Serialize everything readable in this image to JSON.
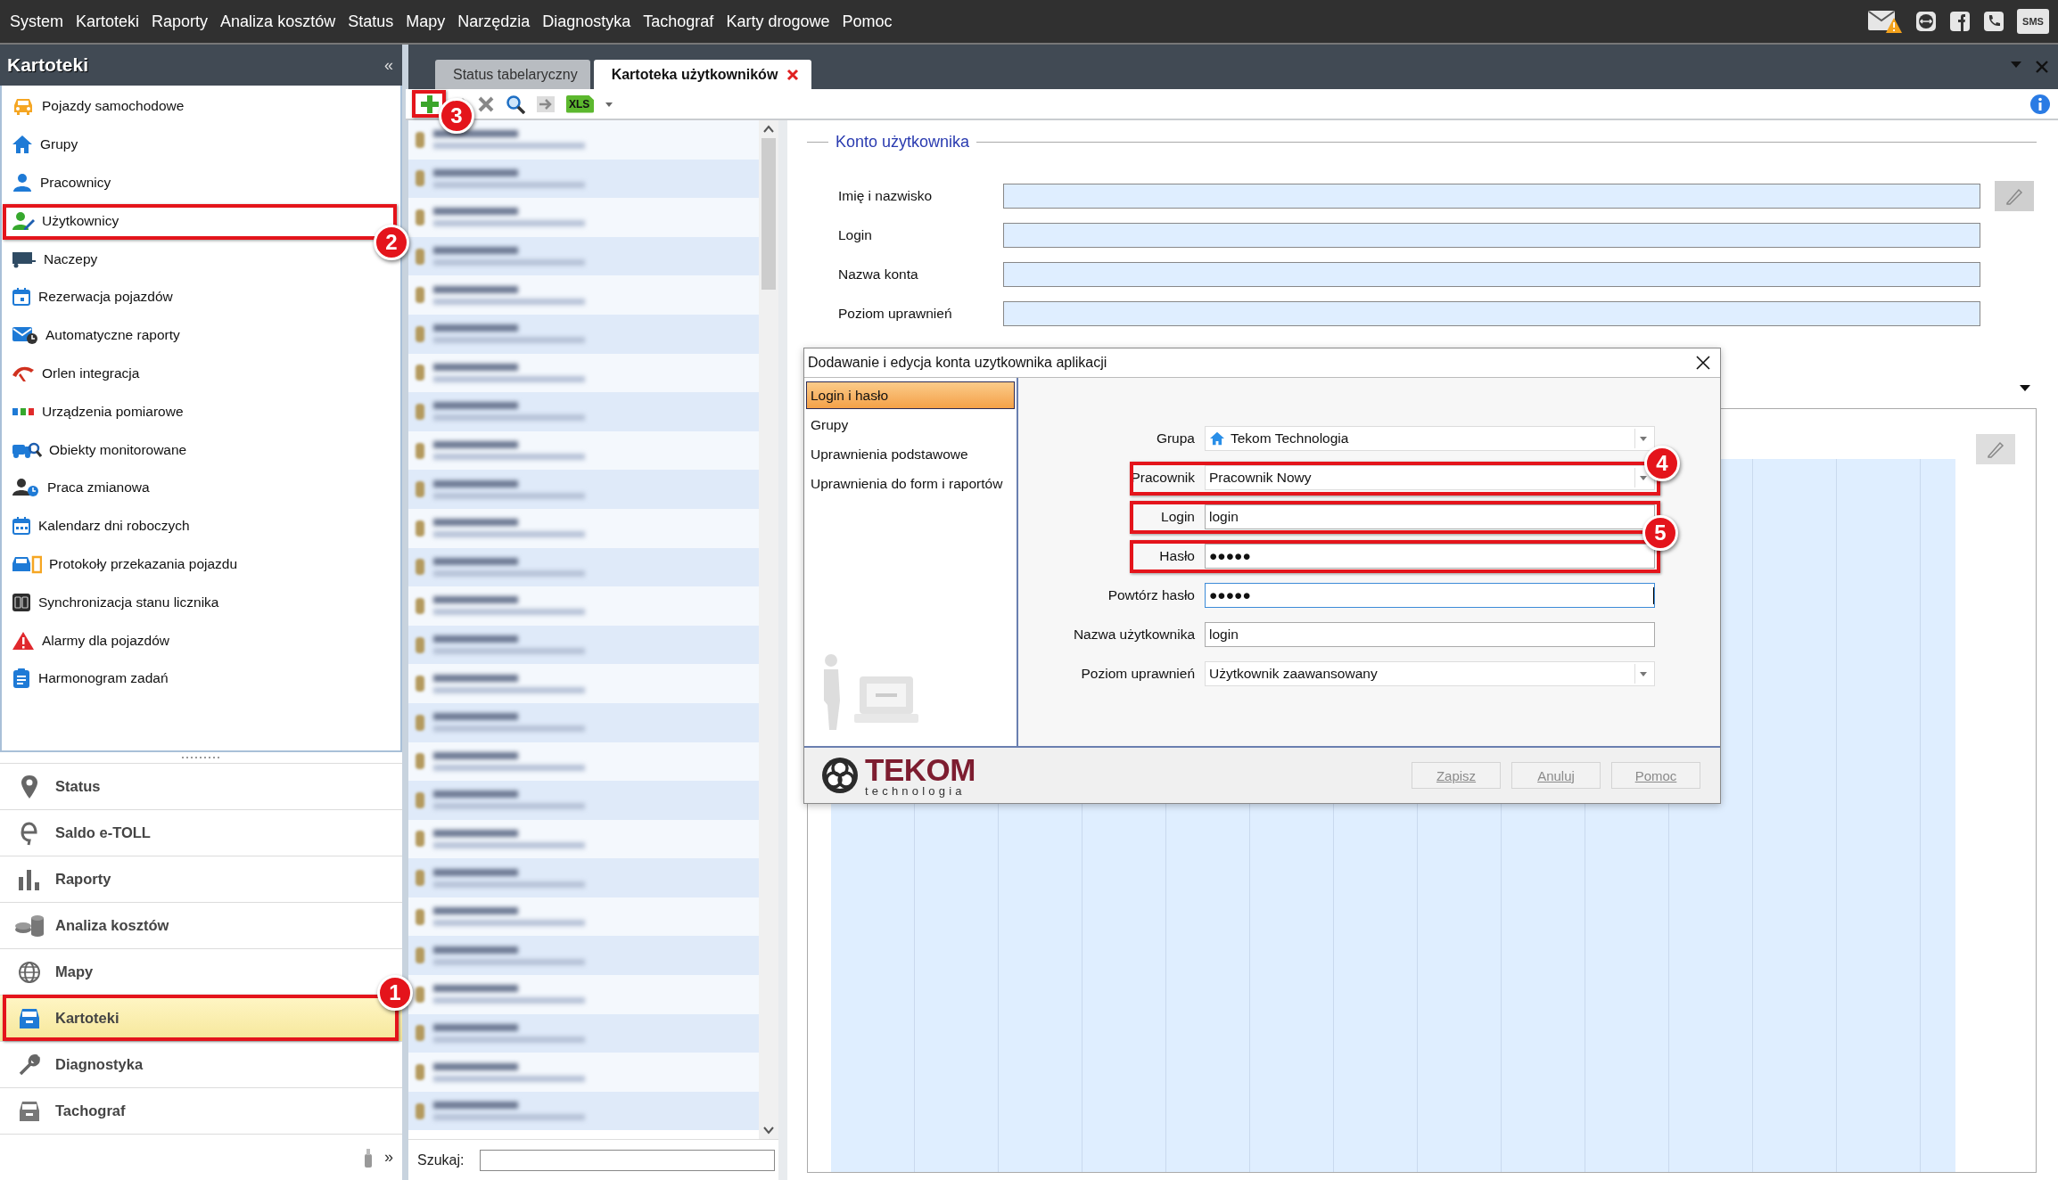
{
  "menu_bar": {
    "items": [
      {
        "label": "System"
      },
      {
        "label": "Kartoteki"
      },
      {
        "label": "Raporty"
      },
      {
        "label": "Analiza kosztów"
      },
      {
        "label": "Status"
      },
      {
        "label": "Mapy"
      },
      {
        "label": "Narzędzia"
      },
      {
        "label": "Diagnostyka"
      },
      {
        "label": "Tachograf"
      },
      {
        "label": "Karty drogowe"
      },
      {
        "label": "Pomoc"
      }
    ],
    "sms_icon_label": "SMS"
  },
  "sidebar": {
    "title": "Kartoteki",
    "collapse_glyph": "«",
    "items": [
      {
        "label": "Pojazdy samochodowe"
      },
      {
        "label": "Grupy"
      },
      {
        "label": "Pracownicy"
      },
      {
        "label": "Użytkownicy"
      },
      {
        "label": "Naczepy"
      },
      {
        "label": "Rezerwacja pojazdów"
      },
      {
        "label": "Automatyczne raporty"
      },
      {
        "label": "Orlen integracja"
      },
      {
        "label": "Urządzenia pomiarowe"
      },
      {
        "label": "Obiekty monitorowane"
      },
      {
        "label": "Praca zmianowa"
      },
      {
        "label": "Kalendarz dni roboczych"
      },
      {
        "label": "Protokoły przekazania pojazdu"
      },
      {
        "label": "Synchronizacja stanu licznika"
      },
      {
        "label": "Alarmy dla pojazdów"
      },
      {
        "label": "Harmonogram zadań"
      }
    ],
    "nav_buttons": [
      {
        "label": "Status",
        "selected": false
      },
      {
        "label": "Saldo e-TOLL",
        "selected": false
      },
      {
        "label": "Raporty",
        "selected": false
      },
      {
        "label": "Analiza kosztów",
        "selected": false
      },
      {
        "label": "Mapy",
        "selected": false
      },
      {
        "label": "Kartoteki",
        "selected": true
      },
      {
        "label": "Diagnostyka",
        "selected": false
      },
      {
        "label": "Tachograf",
        "selected": false
      }
    ],
    "more_glyph": "»"
  },
  "tabs": [
    {
      "label": "Status tabelaryczny",
      "selected": false,
      "closable": false
    },
    {
      "label": "Kartoteka użytkowników",
      "selected": true,
      "closable": true
    }
  ],
  "toolbar": {
    "xls_label": "XLS"
  },
  "user_list": {
    "rows": [
      {
        "kind": "blurred"
      },
      {
        "kind": "blurred"
      },
      {
        "kind": "blurred"
      },
      {
        "kind": "blurred"
      },
      {
        "kind": "blurred"
      },
      {
        "kind": "blurred"
      },
      {
        "kind": "blurred"
      },
      {
        "kind": "blurred"
      },
      {
        "kind": "blurred"
      },
      {
        "kind": "blurred"
      },
      {
        "kind": "blurred"
      },
      {
        "kind": "blurred"
      },
      {
        "kind": "blurred"
      },
      {
        "kind": "blurred"
      },
      {
        "kind": "blurred"
      },
      {
        "kind": "blurred"
      },
      {
        "kind": "blurred"
      },
      {
        "kind": "blurred"
      },
      {
        "kind": "blurred"
      },
      {
        "kind": "blurred"
      },
      {
        "kind": "blurred"
      },
      {
        "kind": "blurred"
      },
      {
        "kind": "blurred"
      },
      {
        "kind": "blurred"
      },
      {
        "kind": "blurred"
      },
      {
        "kind": "blurred"
      }
    ],
    "search_label": "Szukaj:"
  },
  "account": {
    "title": "Konto użytkownika",
    "fields": [
      {
        "label": "Imię i nazwisko"
      },
      {
        "label": "Login"
      },
      {
        "label": "Nazwa konta"
      },
      {
        "label": "Poziom uprawnień"
      }
    ]
  },
  "dialog": {
    "title": "Dodawanie i edycja konta uzytkownika aplikacji",
    "nav": [
      {
        "label": "Login i hasło",
        "selected": true
      },
      {
        "label": "Grupy",
        "selected": false
      },
      {
        "label": "Uprawnienia podstawowe",
        "selected": false
      },
      {
        "label": "Uprawnienia do form i raportów",
        "selected": false
      }
    ],
    "fields": [
      {
        "label": "Grupa",
        "kind": "select",
        "value": "Tekom Technologia",
        "focused": false
      },
      {
        "label": "Pracownik",
        "kind": "select",
        "value": "Pracownik Nowy",
        "focused": false
      },
      {
        "label": "Login",
        "kind": "text",
        "value": "login",
        "focused": false
      },
      {
        "label": "Hasło",
        "kind": "password",
        "value": "●●●●●",
        "focused": false
      },
      {
        "label": "Powtórz hasło",
        "kind": "password",
        "value": "●●●●●",
        "focused": true
      },
      {
        "label": "Nazwa użytkownika",
        "kind": "text",
        "value": "login",
        "focused": false
      },
      {
        "label": "Poziom uprawnień",
        "kind": "select",
        "value": "Użytkownik zaawansowany",
        "focused": false
      }
    ],
    "logo": {
      "name": "TEKOM",
      "tagline": "technologia"
    },
    "buttons": [
      {
        "label": "Zapisz",
        "disabled": true
      },
      {
        "label": "Anuluj",
        "disabled": true
      },
      {
        "label": "Pomoc",
        "disabled": true
      }
    ]
  },
  "callouts": [
    {
      "number": "1"
    },
    {
      "number": "2"
    },
    {
      "number": "3"
    },
    {
      "number": "4"
    },
    {
      "number": "5"
    }
  ]
}
